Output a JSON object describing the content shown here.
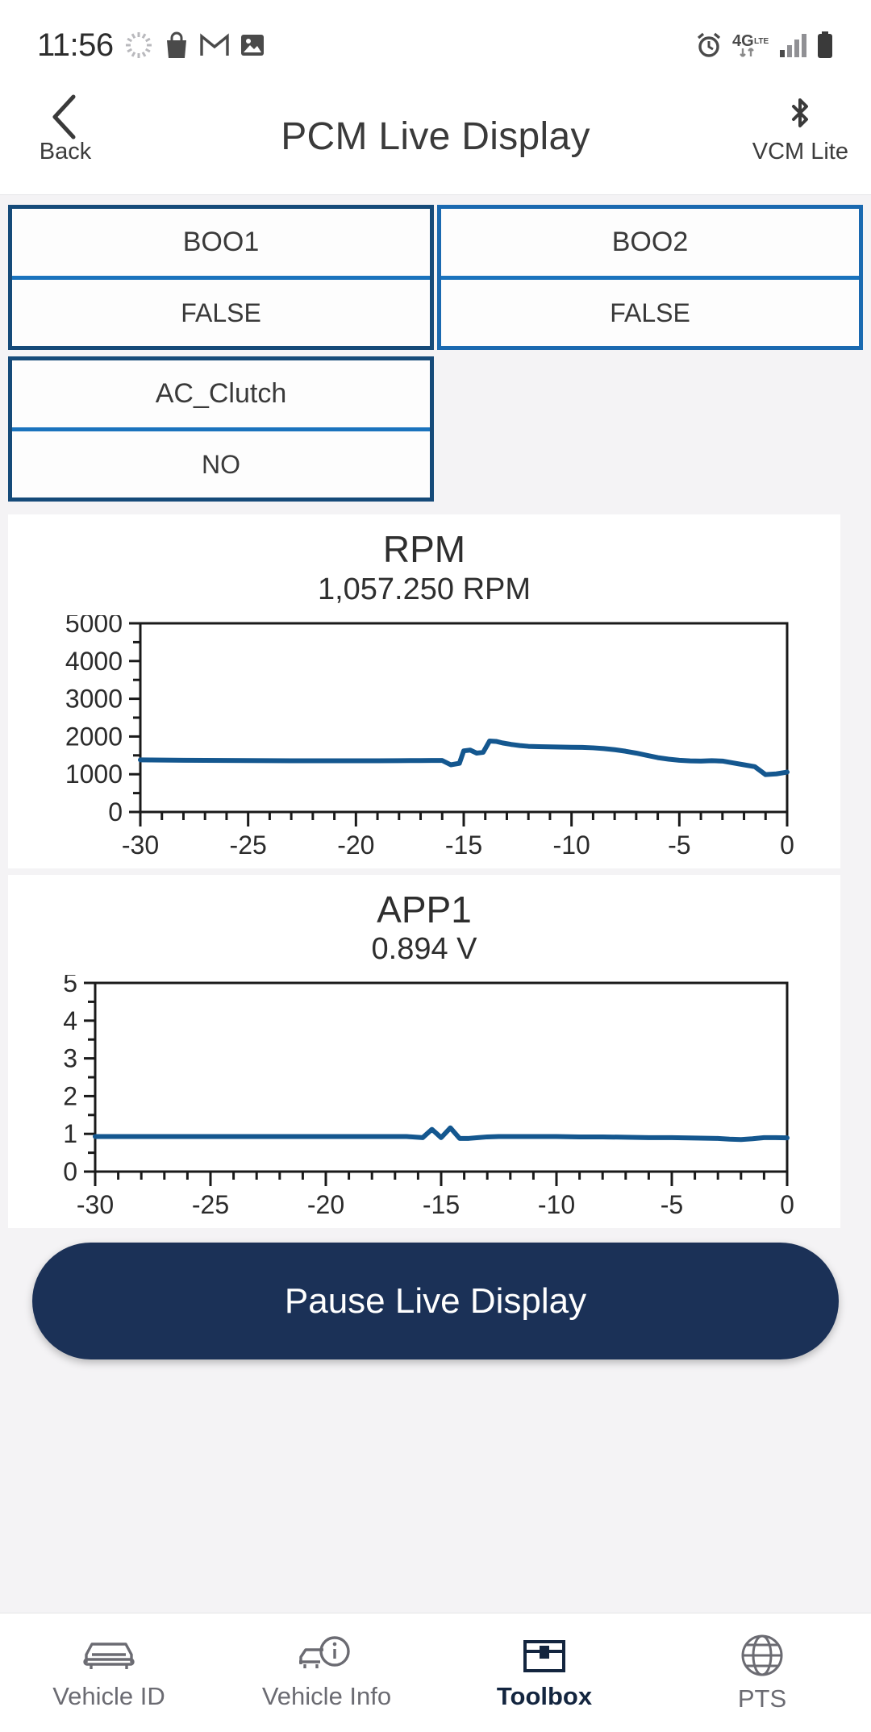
{
  "status_bar": {
    "time": "11:56",
    "left_icons": [
      "loading-spinner-icon",
      "shopping-bag-icon",
      "gmail-icon",
      "photos-icon"
    ],
    "right_icons": [
      "alarm-icon",
      "4g-lte-icon",
      "signal-bars-icon",
      "battery-icon"
    ],
    "network_label": "4G"
  },
  "header": {
    "back_label": "Back",
    "title": "PCM Live Display",
    "right_label": "VCM Lite"
  },
  "pids": [
    {
      "name": "BOO1",
      "value": "FALSE"
    },
    {
      "name": "BOO2",
      "value": "FALSE"
    },
    {
      "name": "AC_Clutch",
      "value": "NO"
    }
  ],
  "footer": {
    "pause_label": "Pause Live Display"
  },
  "bottom_nav": [
    {
      "label": "Vehicle ID",
      "icon": "car-icon",
      "active": false
    },
    {
      "label": "Vehicle Info",
      "icon": "car-info-icon",
      "active": false
    },
    {
      "label": "Toolbox",
      "icon": "toolbox-icon",
      "active": true
    },
    {
      "label": "PTS",
      "icon": "globe-icon",
      "active": false
    }
  ],
  "colors": {
    "accent_navy": "#1b3157",
    "card_border": "#154a79",
    "card_border_light": "#1a69b0",
    "divider_blue": "#1a73bd",
    "plot_line": "#14578f",
    "axis": "#1a1a1a",
    "page_bg": "#f4f3f5",
    "card_bg": "#ffffff"
  },
  "chart_data": [
    {
      "type": "line",
      "title": "RPM",
      "subtitle": "1,057.250 RPM",
      "value": 1057.25,
      "unit": "RPM",
      "xlabel": "",
      "ylabel": "",
      "xlim": [
        -30,
        0
      ],
      "ylim": [
        0,
        5000
      ],
      "xticks": [
        -30,
        -25,
        -20,
        -15,
        -10,
        -5,
        0
      ],
      "xtick_labels": [
        "-30",
        "-25",
        "-20",
        "-15",
        "-10",
        "-5",
        "0"
      ],
      "minor_xtick_step": 1,
      "yticks": [
        0,
        1000,
        2000,
        3000,
        4000,
        5000
      ],
      "ytick_labels": [
        "0",
        "1000",
        "2000",
        "3000",
        "4000",
        "5000"
      ],
      "minor_ytick_step": 500,
      "grid": false,
      "legend": false,
      "line_color": "#14578f",
      "x": [
        -30.0,
        -29.0,
        -28.0,
        -27.0,
        -26.0,
        -25.0,
        -24.0,
        -23.0,
        -22.0,
        -21.0,
        -20.0,
        -19.0,
        -18.0,
        -17.0,
        -16.5,
        -16.0,
        -15.6,
        -15.2,
        -15.0,
        -14.7,
        -14.4,
        -14.1,
        -13.8,
        -13.5,
        -13.2,
        -12.8,
        -12.4,
        -12.0,
        -11.5,
        -11.0,
        -10.5,
        -10.0,
        -9.5,
        -9.0,
        -8.5,
        -8.0,
        -7.5,
        -7.0,
        -6.5,
        -6.0,
        -5.5,
        -5.0,
        -4.5,
        -4.0,
        -3.5,
        -3.0,
        -2.5,
        -2.0,
        -1.5,
        -1.0,
        -0.5,
        0.0
      ],
      "y": [
        1380,
        1375,
        1370,
        1368,
        1365,
        1362,
        1360,
        1358,
        1358,
        1357,
        1356,
        1358,
        1360,
        1362,
        1364,
        1365,
        1250,
        1290,
        1620,
        1640,
        1560,
        1580,
        1880,
        1870,
        1830,
        1790,
        1760,
        1740,
        1730,
        1725,
        1720,
        1715,
        1712,
        1700,
        1680,
        1650,
        1610,
        1560,
        1500,
        1440,
        1400,
        1370,
        1355,
        1350,
        1360,
        1350,
        1300,
        1250,
        1200,
        990,
        1010,
        1057
      ]
    },
    {
      "type": "line",
      "title": "APP1",
      "subtitle": "0.894 V",
      "value": 0.894,
      "unit": "V",
      "xlabel": "",
      "ylabel": "",
      "xlim": [
        -30,
        0
      ],
      "ylim": [
        0,
        5
      ],
      "xticks": [
        -30,
        -25,
        -20,
        -15,
        -10,
        -5,
        0
      ],
      "xtick_labels": [
        "-30",
        "-25",
        "-20",
        "-15",
        "-10",
        "-5",
        "0"
      ],
      "minor_xtick_step": 1,
      "yticks": [
        0,
        1,
        2,
        3,
        4,
        5
      ],
      "ytick_labels": [
        "0",
        "1",
        "2",
        "3",
        "4",
        "5"
      ],
      "minor_ytick_step": 0.5,
      "grid": false,
      "legend": false,
      "line_color": "#14578f",
      "x": [
        -30.0,
        -28.0,
        -26.0,
        -24.0,
        -22.0,
        -20.0,
        -18.0,
        -16.5,
        -15.8,
        -15.4,
        -15.0,
        -14.6,
        -14.2,
        -13.8,
        -13.4,
        -13.0,
        -12.5,
        -12.0,
        -11.0,
        -10.0,
        -9.0,
        -8.0,
        -7.0,
        -6.0,
        -5.0,
        -4.0,
        -3.0,
        -2.5,
        -2.0,
        -1.5,
        -1.0,
        -0.5,
        0.0
      ],
      "y": [
        0.93,
        0.93,
        0.93,
        0.93,
        0.93,
        0.93,
        0.93,
        0.93,
        0.9,
        1.12,
        0.9,
        1.16,
        0.88,
        0.88,
        0.9,
        0.92,
        0.93,
        0.93,
        0.93,
        0.93,
        0.92,
        0.92,
        0.91,
        0.9,
        0.9,
        0.89,
        0.88,
        0.86,
        0.85,
        0.87,
        0.9,
        0.9,
        0.894
      ]
    }
  ]
}
